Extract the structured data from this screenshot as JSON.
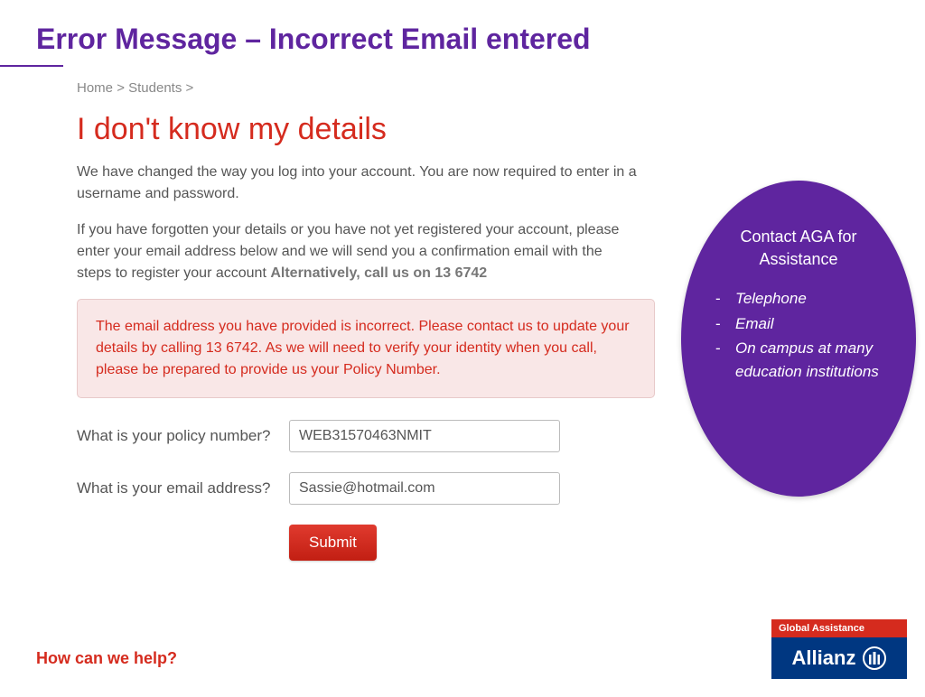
{
  "slide": {
    "title": "Error Message – Incorrect Email entered"
  },
  "breadcrumb": {
    "home": "Home",
    "sep1": ">",
    "students": "Students",
    "sep2": ">"
  },
  "page": {
    "heading": "I don't know my details",
    "intro1": "We have changed the way you log into your account. You are now required to enter in a username and password.",
    "intro2a": "If you have forgotten your details or you have not yet registered your account, please enter your email address below and we will send you a confirmation email with the steps to register your account",
    "intro2b": "Alternatively, call us on 13 6742",
    "error": "The email address you have provided is incorrect. Please contact us to update your details by calling 13 6742. As we will need to verify your identity when you call, please be prepared to provide us your Policy Number."
  },
  "form": {
    "policy_label": "What is your policy number?",
    "policy_value": "WEB31570463NMIT",
    "email_label": "What is your email address?",
    "email_value": "Sassie@hotmail.com",
    "submit": "Submit"
  },
  "callout": {
    "title": "Contact AGA for Assistance",
    "items": {
      "0": "Telephone",
      "1": "Email",
      "2": "On campus at many education institutions"
    }
  },
  "footer": {
    "help": "How can we help?"
  },
  "logo": {
    "ga": "Global Assistance",
    "brand": "Allianz"
  }
}
